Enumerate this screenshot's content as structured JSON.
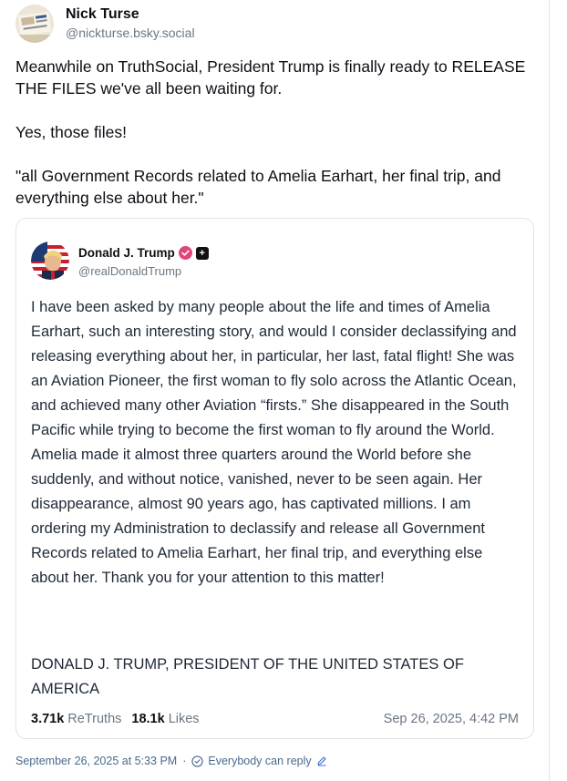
{
  "post": {
    "author_name": "Nick Turse",
    "author_handle": "@nickturse.bsky.social",
    "paragraphs": [
      "Meanwhile on TruthSocial, President Trump is finally ready to RELEASE THE FILES we've all been waiting for.",
      "Yes, those files!",
      "\"all Government Records related to Amelia Earhart, her final trip, and everything else about her.\""
    ],
    "timestamp": "September 26, 2025 at 5:33 PM",
    "reply_setting": "Everybody can reply"
  },
  "quote": {
    "author_name": "Donald J. Trump",
    "author_handle": "@realDonaldTrump",
    "body": "I have been asked by many people about the life and times of Amelia Earhart, such an interesting story, and would I consider declassifying and releasing everything about her, in particular, her last, fatal flight! She was an Aviation Pioneer, the first woman to fly solo across the Atlantic Ocean, and achieved many other Aviation “firsts.” She disappeared in the South Pacific while trying to become the first woman to fly around the World. Amelia made it almost three quarters around the World before she suddenly, and without notice, vanished, never to be seen again. Her disappearance, almost 90 years ago, has captivated millions. I am ordering my Administration to declassify and release all Government Records related to Amelia Earhart, her final trip, and everything else about her. Thank you for your attention to this matter!",
    "signature": "DONALD J. TRUMP, PRESIDENT OF THE UNITED STATES OF AMERICA",
    "retruths_count": "3.71k",
    "retruths_label": "ReTruths",
    "likes_count": "18.1k",
    "likes_label": "Likes",
    "date": "Sep 26, 2025, 4:42 PM"
  },
  "colors": {
    "verified_badge": "#e0457b",
    "muted_text": "#6a7683",
    "footer_text": "#4a6a8a"
  }
}
